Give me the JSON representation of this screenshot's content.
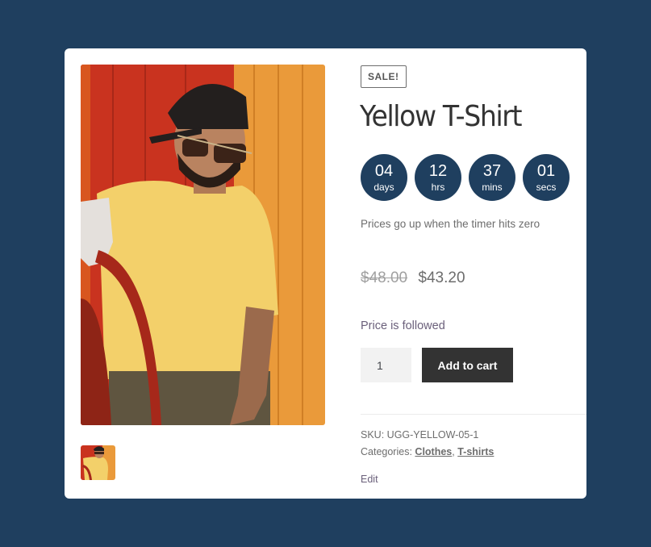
{
  "product": {
    "badge": "SALE!",
    "title": "Yellow T-Shirt",
    "image_alt": "Man in yellow t-shirt, cap and sunglasses sitting on a red chair",
    "thumbnail_alt": "Yellow T-Shirt thumbnail",
    "countdown": [
      {
        "value": "04",
        "label": "days"
      },
      {
        "value": "12",
        "label": "hrs"
      },
      {
        "value": "37",
        "label": "mins"
      },
      {
        "value": "01",
        "label": "secs"
      }
    ],
    "timer_note": "Prices go up when the timer hits zero",
    "regular_price": "$48.00",
    "sale_price": "$43.20",
    "follow_note": "Price is followed",
    "quantity": "1",
    "add_to_cart_label": "Add to cart",
    "sku_label": "SKU:",
    "sku_value": "UGG-YELLOW-05-1",
    "categories_label": "Categories:",
    "categories": [
      "Clothes",
      "T-shirts"
    ],
    "category_separator": ",",
    "edit_label": "Edit"
  },
  "colors": {
    "background": "#1f3f5f",
    "countdown_bg": "#1f3f5f",
    "button_bg": "#333333"
  }
}
